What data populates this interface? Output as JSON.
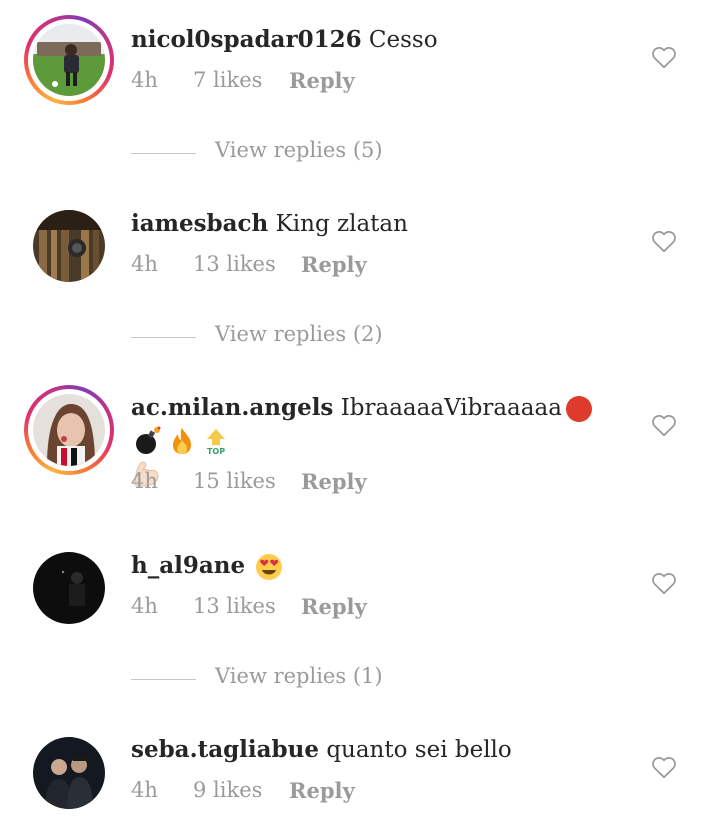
{
  "comments": [
    {
      "username": "nicol0spadar0126",
      "text": "Cesso",
      "time": "4h",
      "likes": "7 likes",
      "reply": "Reply",
      "has_story_ring": true,
      "view_replies": "View replies (5)"
    },
    {
      "username": "iamesbach",
      "text": "King zlatan",
      "time": "4h",
      "likes": "13 likes",
      "reply": "Reply",
      "has_story_ring": false,
      "view_replies": "View replies (2)"
    },
    {
      "username": "ac.milan.angels",
      "text": "IbraaaaaVibraaaaa",
      "emojis": [
        "red-circle",
        "bomb",
        "fire",
        "top-arrow",
        "flexed-biceps"
      ],
      "time": "4h",
      "likes": "15 likes",
      "reply": "Reply",
      "has_story_ring": true
    },
    {
      "username": "h_al9ane",
      "text": "",
      "emojis": [
        "heart-eyes"
      ],
      "time": "4h",
      "likes": "13 likes",
      "reply": "Reply",
      "has_story_ring": false,
      "view_replies": "View replies (1)"
    },
    {
      "username": "seba.tagliabue",
      "text": "quanto sei bello",
      "time": "4h",
      "likes": "9 likes",
      "reply": "Reply",
      "has_story_ring": false
    }
  ],
  "icons": {
    "like": "heart-outline-icon"
  },
  "colors": {
    "text": "#262626",
    "meta": "#9a9a9a",
    "divider": "#c7c7c7"
  }
}
